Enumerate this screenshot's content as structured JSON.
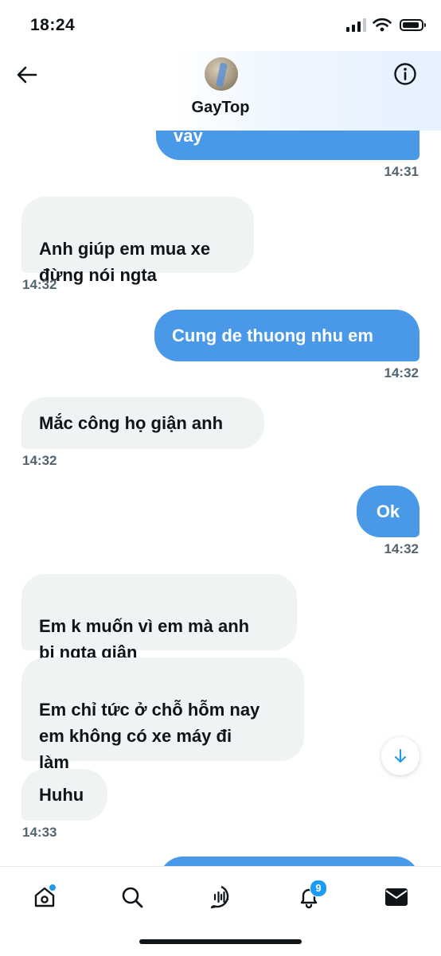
{
  "status_bar": {
    "time": "18:24"
  },
  "header": {
    "contact_name": "GayTop"
  },
  "messages": [
    {
      "side": "out",
      "text": "vay",
      "time": "14:31"
    },
    {
      "side": "in",
      "text": "Anh giúp em mua xe\nđừng nói ngta",
      "time": "14:32"
    },
    {
      "side": "out",
      "text": "Cung de thuong nhu em",
      "time": "14:32"
    },
    {
      "side": "in",
      "text": "Mắc công họ giận anh",
      "time": "14:32"
    },
    {
      "side": "out",
      "text": "Ok",
      "time": "14:32"
    },
    {
      "side": "in",
      "text": "Em k muốn vì em mà anh\nbị ngta giận"
    },
    {
      "side": "in",
      "text": "Em chỉ tức ở chỗ hỗm nay\nem không có xe máy đi\nlàm"
    },
    {
      "side": "in",
      "text": "Huhu",
      "time": "14:33"
    }
  ],
  "bottom_nav": {
    "items": [
      "home-icon",
      "search-icon",
      "spaces-icon",
      "notifications-icon",
      "messages-icon"
    ],
    "notifications_count": "9"
  },
  "colors": {
    "outgoing_bubble": "#4a99e9",
    "incoming_bubble": "#eff3f4",
    "accent": "#1d9bf0"
  }
}
